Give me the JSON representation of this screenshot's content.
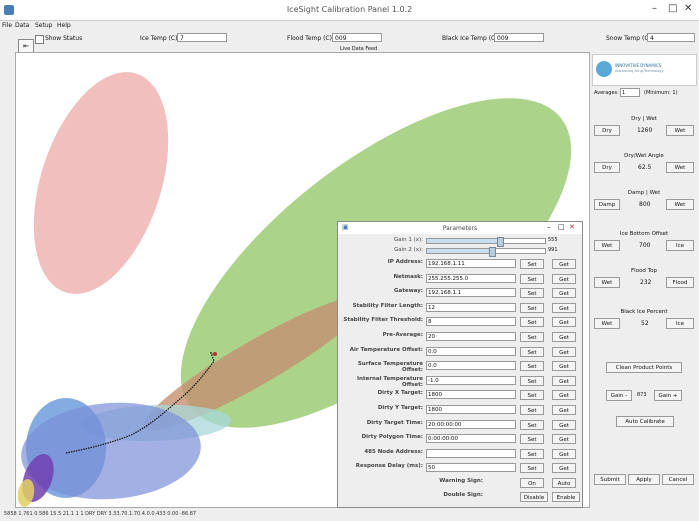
{
  "window": {
    "title": "IceSight Calibration Panel 1.0.2",
    "minimize": "–",
    "maximize": "□",
    "close": "✕"
  },
  "menu": [
    "File",
    "Data",
    "Setup",
    "Help"
  ],
  "toolbar": {
    "show_status": "Show Status",
    "ice_temp_label": "Ice Temp (C):",
    "ice_temp_value": "7",
    "flood_temp_label": "Flood Temp (C):",
    "flood_temp_value": "009",
    "black_ice_label": "Black Ice Temp (C):",
    "black_ice_value": "009",
    "snow_temp_label": "Snow Temp (C):",
    "snow_temp_value": "4",
    "plot_caption": "Live Data Feed"
  },
  "status_line": "5858  1.761  0.586  15.5  21.1 1 1 DRY DRY 3.33.70.1.70.4.0.0.433  0.00  -86.87",
  "plot": {
    "ellipse_colors": [
      "#f0b4b4",
      "#9ecb76",
      "#c49070",
      "#a8d8d8",
      "#5b8fd8",
      "#7a8fd8",
      "#7040b0",
      "#e0d060"
    ]
  },
  "right_panel": {
    "logo_line1": "INNOVATIVE DYNAMICS",
    "logo_line2": "Advancing Icing Technology",
    "averages_label": "Averages:",
    "averages_value": "1",
    "minimum_label": "(Minimum: 1)",
    "dry_wet": {
      "title": "Dry | Wet",
      "left": "Dry",
      "value": "1260",
      "right": "Wet"
    },
    "dry_wet_angle": {
      "title": "Dry/Wet Angle",
      "left": "Dry",
      "value": "62.5",
      "right": "Wet"
    },
    "damp_wet": {
      "title": "Damp | Wet",
      "left": "Damp",
      "value": "800",
      "right": "Wet"
    },
    "ice_bottom": {
      "title": "Ice Bottom Offset",
      "left": "Wet",
      "value": "700",
      "right": "Ice"
    },
    "flood_top": {
      "title": "Flood Top",
      "left": "Wet",
      "value": "232",
      "right": "Flood"
    },
    "black_ice": {
      "title": "Black Ice Percent",
      "left": "Wet",
      "value": "52",
      "right": "Ice"
    },
    "clean_button": "Clean Product Points",
    "gain_minus": "Gain -",
    "gain_value": "873",
    "gain_plus": "Gain +",
    "auto_calibrate": "Auto Calibrate",
    "submit": "Submit",
    "apply": "Apply",
    "cancel": "Cancel"
  },
  "params": {
    "title": "Parameters",
    "gain1_label": "Gain 1 (x):",
    "gain1_value": "555",
    "gain1_level": 0.62,
    "gain2_label": "Gain 2 (x):",
    "gain2_value": "991",
    "gain2_level": 0.55,
    "set": "Set",
    "get": "Get",
    "rows": [
      {
        "label": "IP Address:",
        "value": "192.168.1.11"
      },
      {
        "label": "Netmask:",
        "value": "255.255.255.0"
      },
      {
        "label": "Gateway:",
        "value": "192.168.1.1"
      },
      {
        "label": "Stability Filter Length:",
        "value": "12"
      },
      {
        "label": "Stability Filter Threshold:",
        "value": "8"
      },
      {
        "label": "Pre-Average:",
        "value": "20"
      },
      {
        "label": "Air Temperature Offset:",
        "value": "0.0"
      },
      {
        "label": "Surface Temperature Offset:",
        "value": "0.0"
      },
      {
        "label": "Internal Temperature Offset:",
        "value": "-1.0"
      },
      {
        "label": "Dirty X Target:",
        "value": "1800"
      },
      {
        "label": "Dirty Y Target:",
        "value": "1800"
      },
      {
        "label": "Dirty Target Time:",
        "value": "20:00:00:00"
      },
      {
        "label": "Dirty Polygon Time:",
        "value": "0:00:00:00"
      },
      {
        "label": "485 Node Address:",
        "value": ""
      },
      {
        "label": "Response Delay (ms):",
        "value": "50"
      }
    ],
    "warning_label": "Warning Sign:",
    "warning_on": "On",
    "warning_auto": "Auto",
    "double_label": "Double Sign:",
    "double_disable": "Disable",
    "double_enable": "Enable"
  }
}
